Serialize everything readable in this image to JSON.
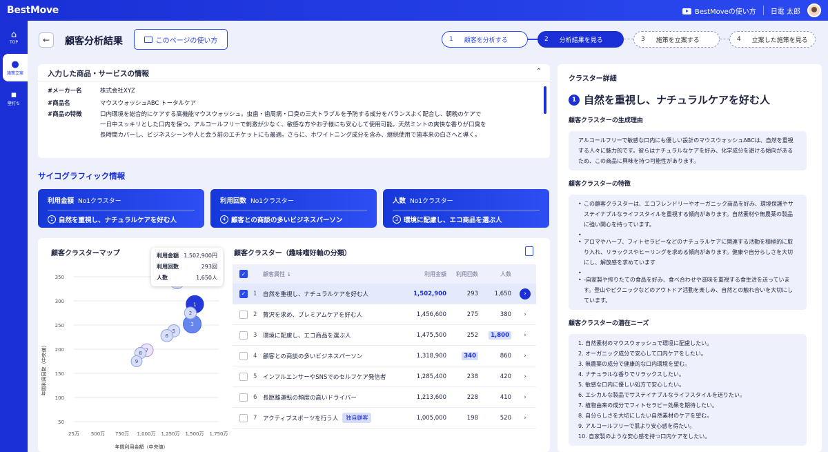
{
  "app": {
    "logo": "BestMove",
    "howto_link": "BestMoveの使い方",
    "user": "日電 太郎"
  },
  "sidebar": [
    {
      "icon": "home-icon",
      "glyph": "⌂",
      "label": "TOP"
    },
    {
      "icon": "pin-icon",
      "glyph": "●",
      "label": "施策立案"
    },
    {
      "icon": "note-icon",
      "glyph": "▪",
      "label": "壁打ち"
    }
  ],
  "header": {
    "title": "顧客分析結果",
    "howto_button": "このページの使い方"
  },
  "steps": [
    {
      "n": "1",
      "label": "顧客を分析する"
    },
    {
      "n": "2",
      "label": "分析結果を見る"
    },
    {
      "n": "3",
      "label": "施策を立案する"
    },
    {
      "n": "4",
      "label": "立案した施策を見る"
    }
  ],
  "info": {
    "title": "入力した商品・サービスの情報",
    "maker_k": "#メーカー名",
    "maker_v": "株式会社XYZ",
    "product_k": "#商品名",
    "product_v": "マウスウォッシュABC トータルケア",
    "feature_k": "#商品の特徴",
    "feature_v": "口内環境を総合的にケアする高機能マウスウォッシュ。虫歯・歯周病・口臭の三大トラブルを予防する成分をバランスよく配合し、朝晩のケアで一日中スッキリとした口内を保つ。アルコールフリーで刺激が少なく、敏感な方やお子様にも安心して使用可能。天然ミントの爽快な香りが口臭を長時間カバーし、ビジネスシーンや人と会う前のエチケットにも最適。さらに、ホワイトニング成分を含み、継続使用で歯本来の白さへと導く。"
  },
  "psychographic": {
    "title": "サイコグラフィック情報",
    "cards": [
      {
        "label": "利用金額",
        "sub": "No1クラスター",
        "n": "1",
        "text": "自然を重視し、ナチュラルケアを好む人"
      },
      {
        "label": "利用回数",
        "sub": "No1クラスター",
        "n": "4",
        "text": "顧客との商談の多いビジネスパーソン"
      },
      {
        "label": "人数",
        "sub": "No1クラスター",
        "n": "3",
        "text": "環境に配慮し、エコ商品を選ぶ人"
      }
    ]
  },
  "map": {
    "title": "顧客クラスターマップ",
    "ylabel": "年間利用回数（中央値）",
    "xlabel": "年間利用金額（中央値）",
    "tooltip": {
      "k1": "利用金額",
      "v1": "1,502,900円",
      "k2": "利用回数",
      "v2": "293回",
      "k3": "人数",
      "v3": "1,650人"
    }
  },
  "chart_data": {
    "type": "scatter",
    "ylim": [
      50,
      350
    ],
    "xlim": [
      250000,
      1750000
    ],
    "yticks": [
      "50",
      "100",
      "150",
      "200",
      "250",
      "300",
      "350"
    ],
    "xticks": [
      "25万",
      "500万",
      "750万",
      "1,000万",
      "1,250万",
      "1,500万",
      "1,750万"
    ],
    "points": [
      {
        "label": "1",
        "x": 1502900,
        "y": 293,
        "size": 1650
      },
      {
        "label": "2",
        "x": 1456600,
        "y": 275,
        "size": 380
      },
      {
        "label": "3",
        "x": 1475500,
        "y": 252,
        "size": 1800
      },
      {
        "label": "4",
        "x": 1318900,
        "y": 340,
        "size": 860
      },
      {
        "label": "5",
        "x": 1285400,
        "y": 238,
        "size": 420
      },
      {
        "label": "6",
        "x": 1213600,
        "y": 228,
        "size": 410
      },
      {
        "label": "7",
        "x": 1005000,
        "y": 198,
        "size": 520
      },
      {
        "label": "8",
        "x": 940000,
        "y": 192,
        "size": 300
      },
      {
        "label": "9",
        "x": 900000,
        "y": 175,
        "size": 250
      }
    ]
  },
  "table": {
    "title": "顧客クラスター（趣味嗜好軸の分類）",
    "headers": {
      "attr": "顧客属性 ↓",
      "amount": "利用金額",
      "count": "利用回数",
      "people": "人数"
    },
    "rows": [
      {
        "i": "1",
        "name": "自然を重視し、ナチュラルケアを好む人",
        "amount": "1,502,900",
        "count": "293",
        "people": "1,650",
        "tag": ""
      },
      {
        "i": "2",
        "name": "贅沢を求め、プレミアムケアを好む人",
        "amount": "1,456,600",
        "count": "275",
        "people": "380",
        "tag": ""
      },
      {
        "i": "3",
        "name": "環境に配慮し、エコ商品を選ぶ人",
        "amount": "1,475,500",
        "count": "252",
        "people": "1,800",
        "tag": ""
      },
      {
        "i": "4",
        "name": "顧客との商談の多いビジネスパーソン",
        "amount": "1,318,900",
        "count": "340",
        "people": "860",
        "tag": ""
      },
      {
        "i": "5",
        "name": "インフルエンサーやSNSでのセルフケア発信者",
        "amount": "1,285,400",
        "count": "238",
        "people": "420",
        "tag": ""
      },
      {
        "i": "6",
        "name": "長距離運転の頻度の高いドライバー",
        "amount": "1,213,600",
        "count": "228",
        "people": "410",
        "tag": ""
      },
      {
        "i": "7",
        "name": "アクティブスポーツを行う人",
        "amount": "1,005,000",
        "count": "198",
        "people": "520",
        "tag": "独自顧客"
      }
    ]
  },
  "detail": {
    "title": "クラスター詳細",
    "n": "1",
    "name": "自然を重視し、ナチュラルケアを好む人",
    "reason_h": "顧客クラスターの生成理由",
    "reason": "アルコールフリーで敏感な口内にも優しい設計のマウスウォッシュABCは、自然を重視する人々に魅力的です。彼らはナチュラルなケアを好み、化学成分を避ける傾向があるため、この商品に興味を持つ可能性があります。",
    "feat_h": "顧客クラスターの特徴",
    "feats": [
      "この顧客クラスターは、エコフレンドリーやオーガニック商品を好み、環境保護やサステイナブルなライフスタイルを重視する傾向があります。自然素材や無農薬の製品に強い関心を持っています。",
      "アロマやハーブ、フィトセラピーなどのナチュラルケアに関連する活動を積極的に取り入れ、リラックスやヒーリングを求める傾向があります。健康や自分らしさを大切にし、解放感を求めています",
      "-自家製や搾りたての食品を好み、食べ合わせや滋味を重視する食生活を送っています。登山やピクニックなどのアウトドア活動を楽しみ、自然との触れ合いを大切にしています。"
    ],
    "needs_h": "顧客クラスターの潜在ニーズ",
    "needs": [
      "1. 自然素材のマウスウォッシュで環境に配慮したい。",
      "2. オーガニック成分で安心して口内ケアをしたい。",
      "3. 無農薬の成分で健康的な口内環境を望む。",
      "4. ナチュラルな香りでリラックスしたい。",
      "5. 敏感な口内に優しい処方で安心したい。",
      "6. エシカルな製品でサステイナブルなライフスタイルを送りたい。",
      "7. 植物由来の成分でフィトセラピー効果を期待したい。",
      "8. 自分らしさを大切にしたい自然素材のケアを望む。",
      "9. アルコールフリーで肌より安心感を得たい。",
      "10. 自家製のような安心感を持つ口内ケアをしたい。"
    ]
  }
}
